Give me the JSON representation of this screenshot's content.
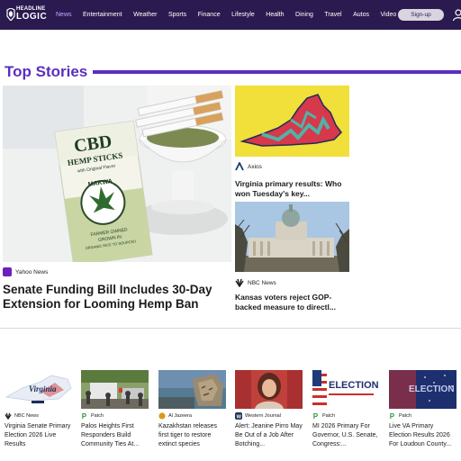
{
  "brand": {
    "line1": "HEADLINE",
    "line2": "LOGIC"
  },
  "nav": [
    "News",
    "Entertainment",
    "Weather",
    "Sports",
    "Finance",
    "Lifestyle",
    "Health",
    "Dining",
    "Travel",
    "Autos",
    "Video"
  ],
  "nav_active": "News",
  "signup_label": "Sign-up",
  "section_title": "Top Stories",
  "hero": {
    "source": "Yahoo News",
    "title": "Senate Funding Bill Includes 30-Day Extension for Looming Hemp Ban",
    "image_text": {
      "brand": "CBD",
      "product": "HEMP STICKS",
      "flavor": "with Original Flavor",
      "maker": "MAKWA",
      "farmer": "FARMER OWNED",
      "grown": "GROWN IN",
      "origin": "ORGANIC RICE TO SOURCED"
    }
  },
  "side": [
    {
      "source": "Axios",
      "title": "Virginia primary results: Who won Tuesday's key..."
    },
    {
      "source": "NBC News",
      "title": "Kansas voters reject GOP-backed measure to directl..."
    }
  ],
  "cards": [
    {
      "source": "NBC News",
      "title": "Virginia Senate Primary Election 2026 Live Results",
      "image_text": "Virginia",
      "logo_color": "#222222"
    },
    {
      "source": "Patch",
      "title": "Palos Heights First Responders Build Community Ties At...",
      "logo_color": "#2e9a3f"
    },
    {
      "source": "Al Jazeera",
      "title": "Kazakhstan releases first tiger to restore extinct species",
      "logo_color": "#d99a1a"
    },
    {
      "source": "Western Journal",
      "title": "Alert: Jeanine Pirro May Be Out of a Job After Botching...",
      "logo_color": "#1d3557"
    },
    {
      "source": "Patch",
      "title": "MI 2026 Primary For Governor, U.S. Senate, Congress:...",
      "image_text": "ELECTION 2026",
      "logo_color": "#2e9a3f"
    },
    {
      "source": "Patch",
      "title": "Live VA Primary Election Results 2026 For Loudoun County...",
      "image_text": "ELECTION 2026",
      "logo_color": "#2e9a3f"
    }
  ],
  "colors": {
    "nav_bg": "#2b1a4f",
    "accent": "#5a2fbf",
    "active_nav": "#c6a8ff"
  },
  "icons": {
    "user": "user-icon"
  }
}
